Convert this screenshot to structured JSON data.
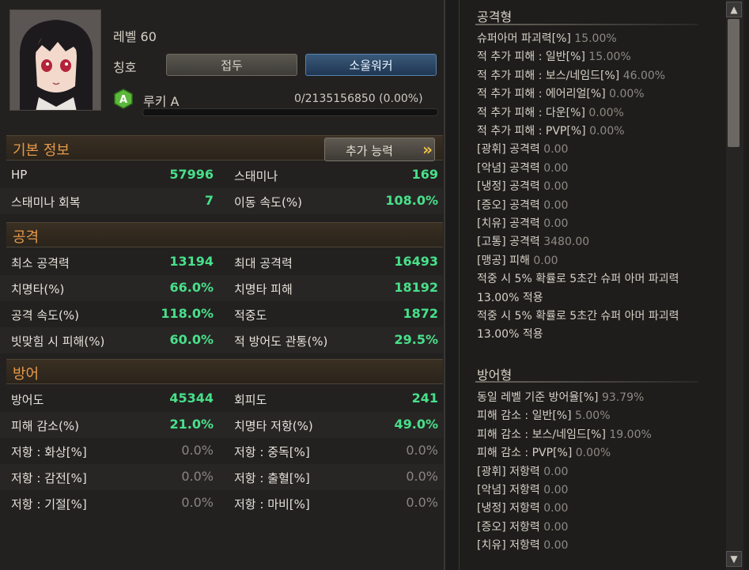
{
  "profile": {
    "level": "레벨 60",
    "title_label": "칭호",
    "title_buttons": [
      "접두",
      "소울워커"
    ],
    "grade_badge": "A",
    "rank": "루키 A",
    "exp": "0/2135156850 (0.00%)",
    "exp_fraction": 0.0
  },
  "basic": {
    "section": "기본 정보",
    "more_button": "추가 능력",
    "rows": [
      {
        "k1": "HP",
        "v1": "57996",
        "k2": "스태미나",
        "v2": "169"
      },
      {
        "k1": "스태미나 회복",
        "v1": "7",
        "k2": "이동 속도(%)",
        "v2": "108.0%"
      }
    ]
  },
  "attack": {
    "section": "공격",
    "rows": [
      {
        "k1": "최소 공격력",
        "v1": "13194",
        "k2": "최대 공격력",
        "v2": "16493"
      },
      {
        "k1": "치명타(%)",
        "v1": "66.0%",
        "k2": "치명타 피해",
        "v2": "18192"
      },
      {
        "k1": "공격 속도(%)",
        "v1": "118.0%",
        "k2": "적중도",
        "v2": "1872"
      },
      {
        "k1": "빗맞힘 시 피해(%)",
        "v1": "60.0%",
        "k2": "적 방어도 관통(%)",
        "v2": "29.5%"
      }
    ]
  },
  "defense": {
    "section": "방어",
    "rows": [
      {
        "k1": "방어도",
        "v1": "45344",
        "k2": "회피도",
        "v2": "241"
      },
      {
        "k1": "피해 감소(%)",
        "v1": "21.0%",
        "k2": "치명타 저항(%)",
        "v2": "49.0%"
      },
      {
        "k1": "저항 : 화상[%]",
        "v1": "0.0%",
        "k2": "저항 : 중독[%]",
        "v2": "0.0%"
      },
      {
        "k1": "저항 : 감전[%]",
        "v1": "0.0%",
        "k2": "저항 : 출혈[%]",
        "v2": "0.0%"
      },
      {
        "k1": "저항 : 기절[%]",
        "v1": "0.0%",
        "k2": "저항 : 마비[%]",
        "v2": "0.0%"
      }
    ]
  },
  "extra": {
    "attack_head": "공격형",
    "attack_lines": [
      {
        "k": "슈퍼아머 파괴력[%]",
        "v": "15.00%"
      },
      {
        "k": "적 추가 피해 : 일반[%]",
        "v": "15.00%"
      },
      {
        "k": "적 추가 피해 : 보스/네임드[%]",
        "v": "46.00%"
      },
      {
        "k": "적 추가 피해 : 에어리얼[%]",
        "v": "0.00%"
      },
      {
        "k": "적 추가 피해 : 다운[%]",
        "v": "0.00%"
      },
      {
        "k": "적 추가 피해 : PVP[%]",
        "v": "0.00%"
      },
      {
        "k": "[광휘]  공격력",
        "v": "0.00"
      },
      {
        "k": "[악념]  공격력",
        "v": "0.00"
      },
      {
        "k": "[냉정]  공격력",
        "v": "0.00"
      },
      {
        "k": "[증오]  공격력",
        "v": "0.00"
      },
      {
        "k": "[치유]  공격력",
        "v": "0.00"
      },
      {
        "k": "[고통]  공격력",
        "v": "3480.00"
      },
      {
        "k": "[맹공] 피해",
        "v": "0.00"
      },
      {
        "k": "적중 시 5% 확률로 5초간 슈퍼 아머 파괴력",
        "v": ""
      },
      {
        "k": "13.00% 적용",
        "v": ""
      },
      {
        "k": "적중 시 5% 확률로 5초간 슈퍼 아머 파괴력",
        "v": ""
      },
      {
        "k": "13.00% 적용",
        "v": ""
      }
    ],
    "defense_head": "방어형",
    "defense_lines": [
      {
        "k": "동일 레벨 기준 방어율[%]",
        "v": "93.79%"
      },
      {
        "k": "피해 감소 : 일반[%]",
        "v": "5.00%"
      },
      {
        "k": "피해 감소 : 보스/네임드[%]",
        "v": "19.00%"
      },
      {
        "k": "피해 감소 : PVP[%]",
        "v": "0.00%"
      },
      {
        "k": "[광휘]  저항력",
        "v": "0.00"
      },
      {
        "k": "[악념]  저항력",
        "v": "0.00"
      },
      {
        "k": "[냉정]  저항력",
        "v": "0.00"
      },
      {
        "k": "[증오]  저항력",
        "v": "0.00"
      },
      {
        "k": "[치유]  저항력",
        "v": "0.00"
      }
    ]
  },
  "scrollbar": {
    "up": "▲",
    "down": "▼"
  }
}
